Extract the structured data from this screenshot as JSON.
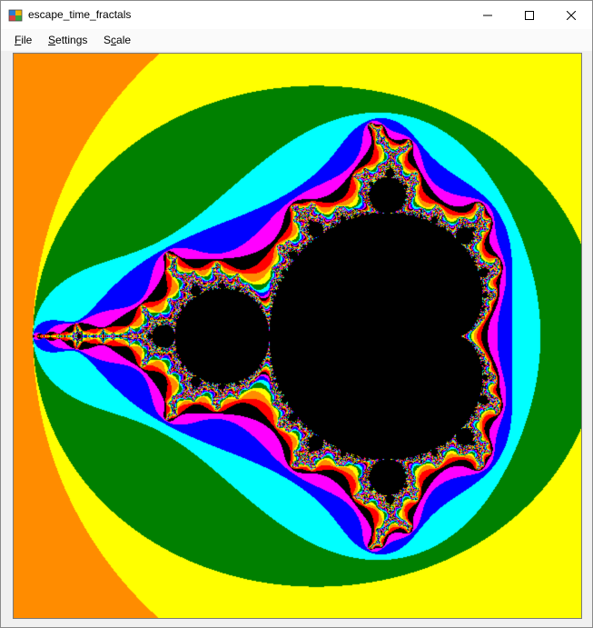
{
  "window": {
    "title": "escape_time_fractals",
    "controls": {
      "minimize": "minimize-icon",
      "maximize": "maximize-icon",
      "close": "close-icon"
    }
  },
  "menu": [
    {
      "label": "File",
      "accel": "F"
    },
    {
      "label": "Settings",
      "accel": "S"
    },
    {
      "label": "Scale",
      "accel": "c"
    }
  ],
  "fractal": {
    "type": "mandelbrot",
    "center": [
      -0.6,
      0.0
    ],
    "span": 3.0,
    "max_iter": 120,
    "interior_color": "#000000",
    "palette": [
      "#ff0000",
      "#ff8c00",
      "#ffff00",
      "#008000",
      "#00ffff",
      "#0000ff",
      "#ff00ff",
      "#000000"
    ]
  }
}
